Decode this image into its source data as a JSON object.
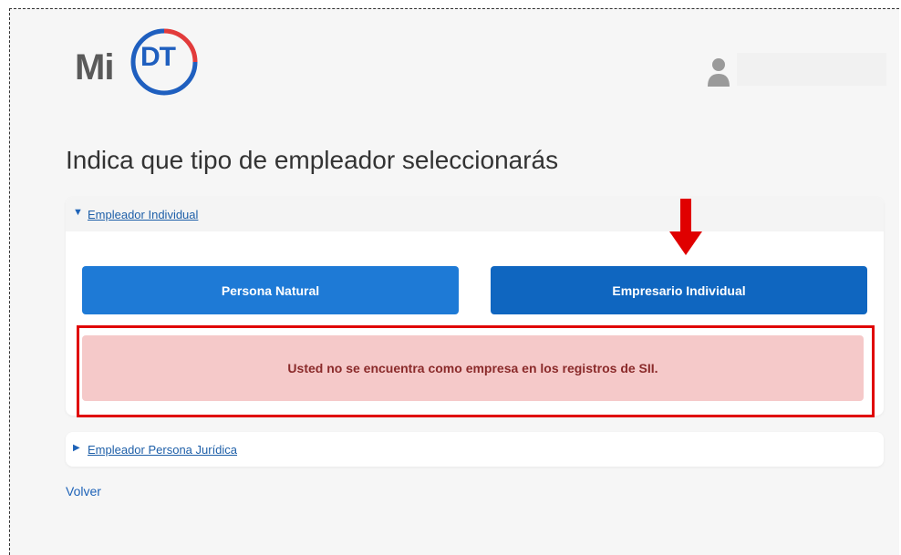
{
  "header": {
    "logo_mi": "Mi",
    "logo_dt": "DT",
    "user_icon": "user-icon"
  },
  "page": {
    "title": "Indica que tipo de empleador seleccionarás"
  },
  "accordion": [
    {
      "label": "Empleador Individual",
      "expanded": true,
      "buttons": [
        {
          "label": "Persona Natural"
        },
        {
          "label": "Empresario Individual"
        }
      ],
      "alert": "Usted no se encuentra como empresa en los registros de SII."
    },
    {
      "label": "Empleador Persona Jurídica",
      "expanded": false
    }
  ],
  "back_link": "Volver",
  "colors": {
    "primary_button": "#1e7ad6",
    "alert_bg": "#f5c9c9",
    "annotation_red": "#e00000"
  }
}
